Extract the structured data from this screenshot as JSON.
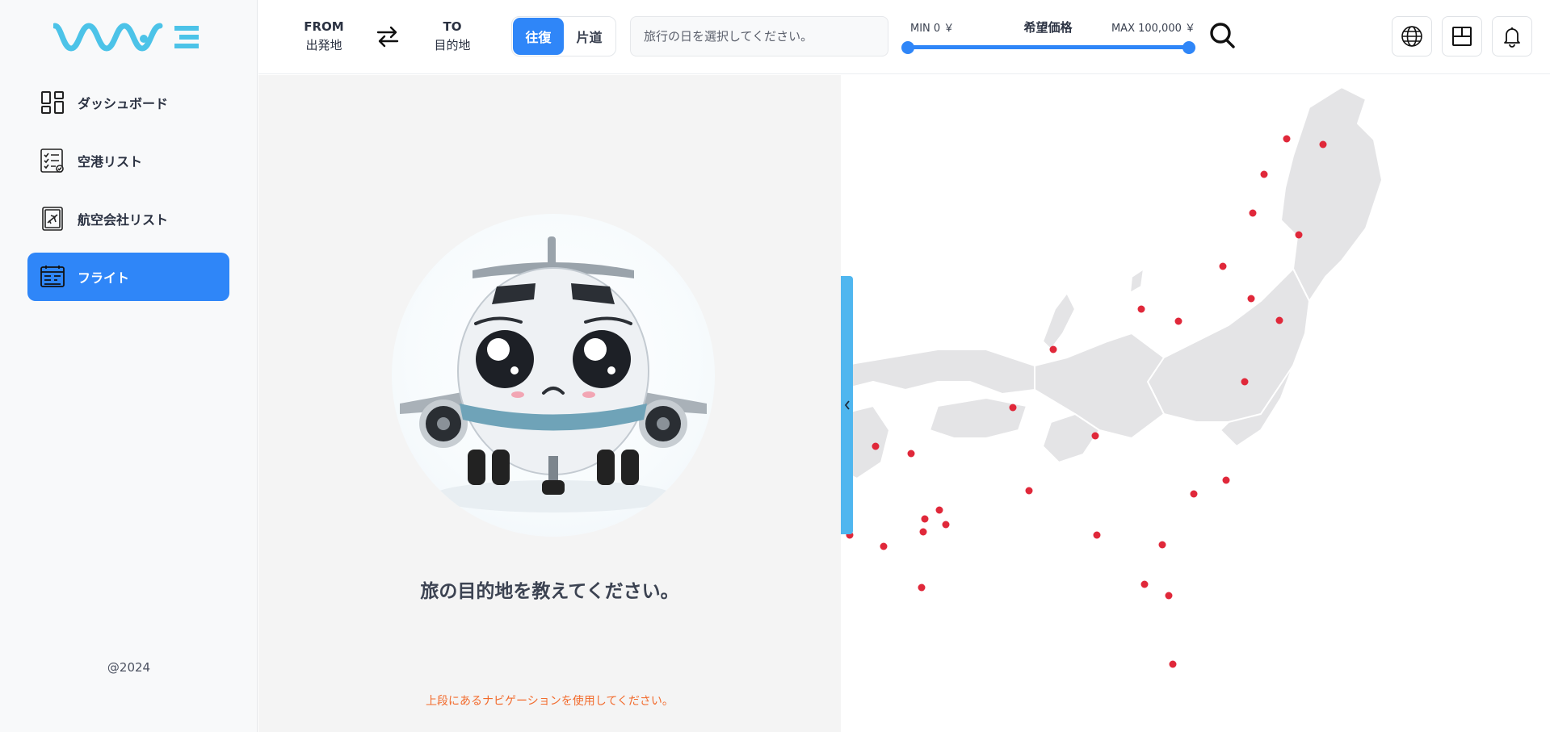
{
  "sidebar": {
    "logo_alt": "WAVE",
    "items": [
      {
        "label": "ダッシュボード",
        "icon": "dashboard-icon",
        "active": false
      },
      {
        "label": "空港リスト",
        "icon": "checklist-icon",
        "active": false
      },
      {
        "label": "航空会社リスト",
        "icon": "airline-icon",
        "active": false
      },
      {
        "label": "フライト",
        "icon": "flight-schedule-icon",
        "active": true
      }
    ],
    "copyright": "@2024"
  },
  "header": {
    "from_label": "FROM",
    "from_sub": "出発地",
    "to_label": "TO",
    "to_sub": "目的地",
    "trip_types": [
      "往復",
      "片道"
    ],
    "trip_selected": "往復",
    "date_placeholder": "旅行の日を選択してください。",
    "price": {
      "min_label": "MIN 0 ￥",
      "max_label": "MAX 100,000 ￥",
      "title": "希望価格",
      "min_value": 0,
      "max_value": 100000
    },
    "icons": [
      "search-icon",
      "globe-icon",
      "layout-icon",
      "bell-icon"
    ]
  },
  "main": {
    "prompt": "旅の目的地を教えてください。",
    "hint": "上段にあるナビゲーションを使用してください。"
  },
  "colors": {
    "accent": "#2f86f8",
    "logo": "#4cc3e8",
    "collapse_bar": "#4fb6ef",
    "map_land": "#e4e4e6",
    "map_dot": "#e0283a",
    "hint": "#f26b2d"
  }
}
